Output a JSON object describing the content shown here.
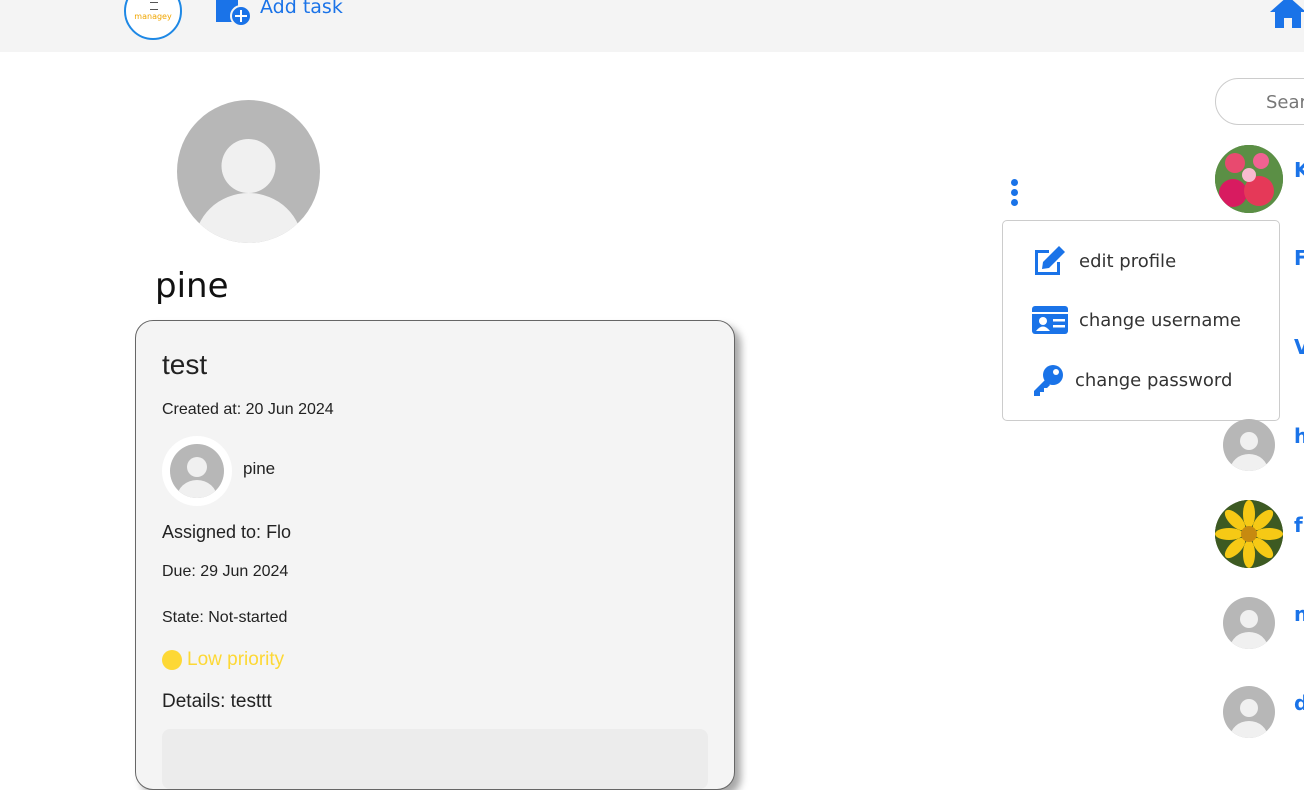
{
  "header": {
    "logo_text": "managey",
    "add_task_label": "Add task"
  },
  "profile": {
    "username": "pine"
  },
  "task": {
    "title": "test",
    "created": "Created at: 20 Jun 2024",
    "creator": "pine",
    "assigned": "Assigned to: Flo",
    "due": "Due: 29 Jun 2024",
    "state": "State: Not-started",
    "priority": "Low priority",
    "priority_color": "#fdd835",
    "details": "Details: testtt"
  },
  "menu": {
    "items": [
      {
        "label": "edit profile",
        "icon": "edit-icon"
      },
      {
        "label": "change username",
        "icon": "id-card-icon"
      },
      {
        "label": "change password",
        "icon": "key-icon"
      }
    ]
  },
  "sidebar": {
    "search_placeholder": "Sear",
    "users": [
      {
        "initial": "K",
        "avatar": "flower-photo"
      },
      {
        "initial": "F",
        "avatar": "none"
      },
      {
        "initial": "V",
        "avatar": "none"
      },
      {
        "initial": "h",
        "avatar": "default"
      },
      {
        "initial": "fı",
        "avatar": "sunflower-photo"
      },
      {
        "initial": "n",
        "avatar": "default"
      },
      {
        "initial": "d",
        "avatar": "default"
      }
    ]
  },
  "colors": {
    "accent": "#1a73e8",
    "card_bg": "#f4f4f4",
    "avatar_grey": "#b7b7b7"
  }
}
